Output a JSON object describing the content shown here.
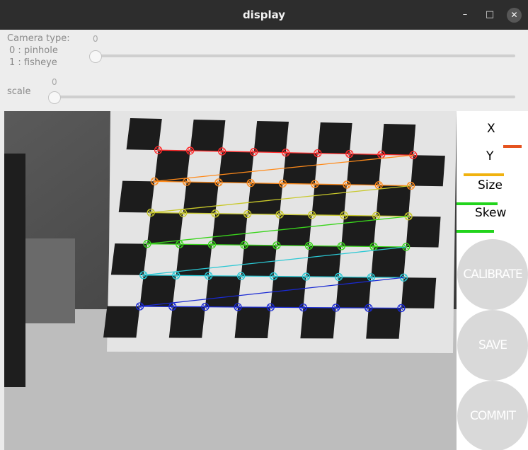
{
  "window": {
    "title": "display",
    "minimize_glyph": "–",
    "maximize_glyph": "□",
    "close_glyph": "✕"
  },
  "controls": {
    "camera_type_label_1": "Camera type:",
    "camera_type_label_2": "0 : pinhole",
    "camera_type_label_3": "1 : fisheye",
    "camera_type_value": "0",
    "scale_label": "scale",
    "scale_value": "0"
  },
  "sidebar": {
    "x_label": "X",
    "y_label": "Y",
    "size_label": "Size",
    "skew_label": "Skew",
    "calibrate_label": "CALIBRATE",
    "save_label": "SAVE",
    "commit_label": "COMMIT",
    "colors": {
      "x_bar": "#e5531f",
      "y_bar": "#f0b20f",
      "size_bar": "#22d41c",
      "skew_bar": "#22d41c"
    }
  },
  "chessboard": {
    "corner_colors": [
      "#ff2a2a",
      "#ff8a1a",
      "#c8c82a",
      "#3ad41c",
      "#2ac8d4",
      "#1a2ad4"
    ],
    "grid_rows": 6,
    "grid_cols": 9
  }
}
